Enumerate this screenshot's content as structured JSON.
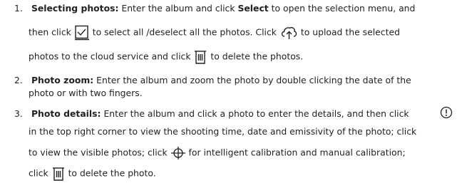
{
  "items": [
    {
      "number": "1.",
      "title": "Selecting photos:",
      "l1a": "Enter the album and click ",
      "l1b": "Select",
      "l1c": " to open the selection menu, and",
      "l2a": "then click ",
      "l2b": " to select all /deselect all the photos. Click ",
      "l2c": " to upload the selected",
      "l3a": "photos to the cloud service and click ",
      "l3b": " to delete the photos."
    },
    {
      "number": "2.",
      "title": "Photo zoom:",
      "l1": " Enter the album and zoom the photo by double clicking the date of the",
      "l2": "photo or with two fingers."
    },
    {
      "number": "3.",
      "title": "Photo details:",
      "l1": " Enter the album and click a photo to enter the details, and then click",
      "l2": "in the top right corner to view the shooting time, date and emissivity of the photo; click",
      "l3a": "to view the visible photos; click ",
      "l3b": " for intelligent calibration and manual calibration;",
      "l4a": "click ",
      "l4b": " to delete the photo."
    }
  ],
  "icons": {
    "select_all": "checkbox-icon",
    "upload": "cloud-upload-icon",
    "delete": "trash-icon",
    "info": "info-icon",
    "calibration": "crosshair-icon"
  }
}
